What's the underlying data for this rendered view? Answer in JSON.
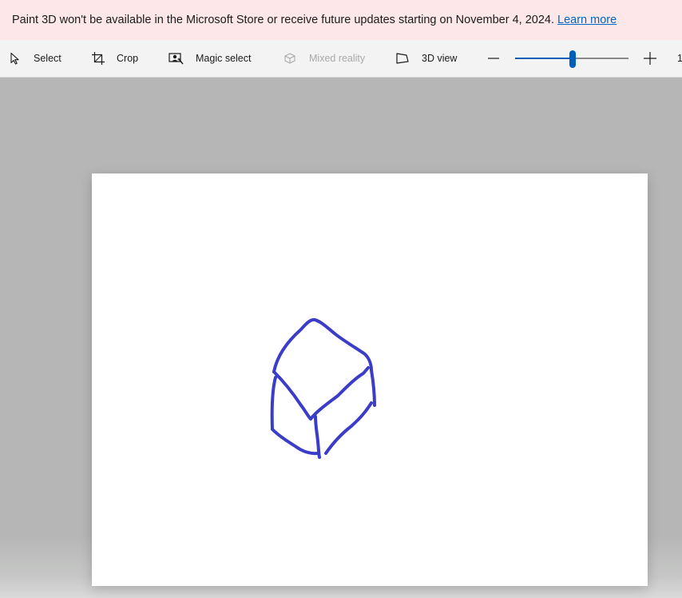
{
  "banner": {
    "message": "Paint 3D won't be available in the Microsoft Store or receive future updates starting on November 4, 2024.",
    "link_label": "Learn more"
  },
  "toolbar": {
    "tools": [
      {
        "label": "Select",
        "icon": "select-arrow-icon",
        "enabled": true
      },
      {
        "label": "Crop",
        "icon": "crop-icon",
        "enabled": true
      },
      {
        "label": "Magic select",
        "icon": "magic-select-icon",
        "enabled": true
      },
      {
        "label": "Mixed reality",
        "icon": "mixed-reality-icon",
        "enabled": false
      },
      {
        "label": "3D view",
        "icon": "3d-view-icon",
        "enabled": true
      }
    ],
    "zoom": {
      "zoom_out_icon": "minus-icon",
      "zoom_in_icon": "plus-icon",
      "slider_level": 0.5,
      "percent_text": "1"
    }
  },
  "canvas": {
    "background": "#ffffff",
    "stroke_color": "#3b3dc8",
    "drawing": "hand-drawn cube sketch"
  },
  "colors": {
    "banner_bg": "#fde7e9",
    "toolbar_bg": "#f3f3f3",
    "workspace_bg": "#b5b6b5",
    "accent": "#005fb8",
    "link": "#0067c0"
  }
}
